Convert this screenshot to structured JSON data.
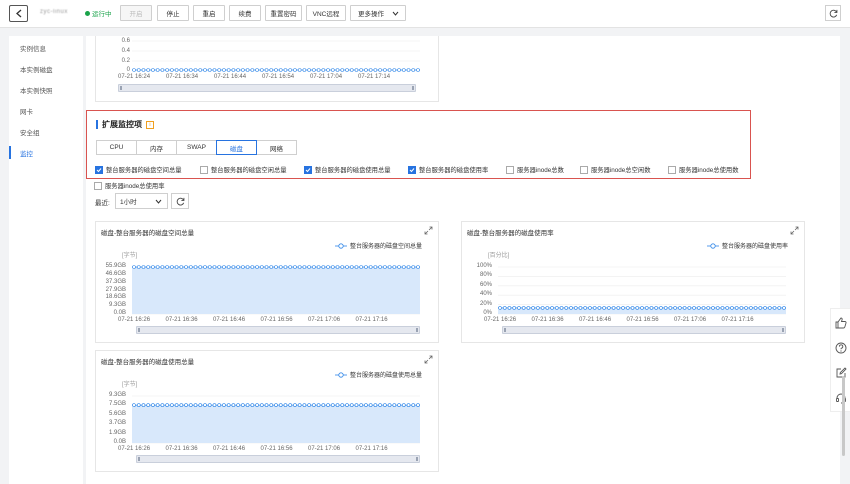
{
  "topbar": {
    "instance_name": "zyc-linux",
    "status": "运行中",
    "buttons": [
      {
        "label": "开启",
        "disabled": true
      },
      {
        "label": "停止"
      },
      {
        "label": "重启"
      },
      {
        "label": "续费"
      },
      {
        "label": "重置密码"
      },
      {
        "label": "VNC远程"
      },
      {
        "label": "更多操作"
      }
    ]
  },
  "sidebar": {
    "items": [
      "实例信息",
      "本实例磁盘",
      "本实例快照",
      "网卡",
      "安全组",
      "监控"
    ],
    "active_index": 5
  },
  "top_chart": {
    "y_ticks": [
      "0.6",
      "0.4",
      "0.2",
      "0"
    ],
    "x_ticks": [
      "07-21 16:24",
      "07-21 16:34",
      "07-21 16:44",
      "07-21 16:54",
      "07-21 17:04",
      "07-21 17:14"
    ]
  },
  "ext_monitor": {
    "title": "扩展监控项",
    "info": "i",
    "tabs": [
      "CPU",
      "内存",
      "SWAP",
      "磁盘",
      "网络"
    ],
    "active_tab": 3,
    "checkboxes": [
      {
        "label": "整台服务器的磁盘空间总量",
        "checked": true
      },
      {
        "label": "整台服务器的磁盘空闲总量",
        "checked": false
      },
      {
        "label": "整台服务器的磁盘使用总量",
        "checked": true
      },
      {
        "label": "整台服务器的磁盘使用率",
        "checked": true
      },
      {
        "label": "服务器inode总数",
        "checked": false
      },
      {
        "label": "服务器inode总空闲数",
        "checked": false
      },
      {
        "label": "服务器inode总使用数",
        "checked": false
      },
      {
        "label": "服务器inode总使用率",
        "checked": false
      }
    ]
  },
  "period": {
    "label": "最近:",
    "value": "1小时"
  },
  "colors": {
    "accent": "#2773e0",
    "series": "#2f86e8",
    "area": "#d8e8fb",
    "border_red": "#d9534f",
    "ok_green": "#1aa34a"
  },
  "chart_data": [
    {
      "type": "line",
      "title": "磁盘-整台服务器的磁盘空间总量",
      "legend": "整台服务器的磁盘空间总量",
      "unit": "[字节]",
      "y_ticks": [
        "55.9GB",
        "46.6GB",
        "37.3GB",
        "27.9GB",
        "18.6GB",
        "9.3GB",
        "0.0B"
      ],
      "x_ticks": [
        "07-21 16:26",
        "07-21 16:36",
        "07-21 16:46",
        "07-21 16:56",
        "07-21 17:06",
        "07-21 17:16"
      ],
      "ylim": [
        0,
        55.9
      ],
      "series": [
        {
          "name": "整台服务器的磁盘空间总量",
          "values": [
            55.9
          ]
        }
      ]
    },
    {
      "type": "line",
      "title": "磁盘-整台服务器的磁盘使用率",
      "legend": "整台服务器的磁盘使用率",
      "unit": "[百分比]",
      "y_ticks": [
        "100%",
        "80%",
        "60%",
        "40%",
        "20%",
        "0%"
      ],
      "x_ticks": [
        "07-21 16:26",
        "07-21 16:36",
        "07-21 16:46",
        "07-21 16:56",
        "07-21 17:06",
        "07-21 17:16"
      ],
      "ylim": [
        0,
        100
      ],
      "series": [
        {
          "name": "整台服务器的磁盘使用率",
          "values": [
            13
          ]
        }
      ]
    },
    {
      "type": "line",
      "title": "磁盘-整台服务器的磁盘使用总量",
      "legend": "整台服务器的磁盘使用总量",
      "unit": "[字节]",
      "y_ticks": [
        "9.3GB",
        "7.5GB",
        "5.6GB",
        "3.7GB",
        "1.9GB",
        "0.0B"
      ],
      "x_ticks": [
        "07-21 16:26",
        "07-21 16:36",
        "07-21 16:46",
        "07-21 16:56",
        "07-21 17:06",
        "07-21 17:16"
      ],
      "ylim": [
        0,
        9.3
      ],
      "series": [
        {
          "name": "整台服务器的磁盘使用总量",
          "values": [
            7.5
          ]
        }
      ]
    }
  ]
}
